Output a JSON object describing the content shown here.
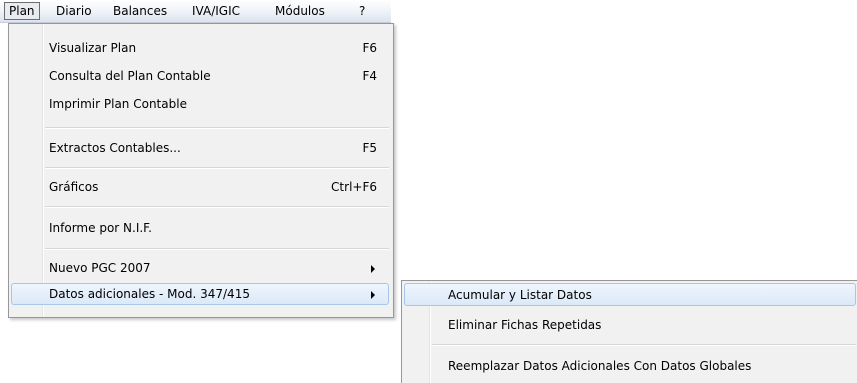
{
  "menubar": {
    "items": [
      "Plan",
      "Diario",
      "Balances",
      "IVA/IGIC",
      "Módulos",
      "?"
    ]
  },
  "plan_menu": {
    "items": [
      {
        "label": "Visualizar Plan",
        "shortcut": "F6"
      },
      {
        "label": "Consulta del Plan Contable",
        "shortcut": "F4"
      },
      {
        "label": "Imprimir Plan Contable",
        "shortcut": ""
      },
      {
        "label": "Extractos Contables...",
        "shortcut": "F5"
      },
      {
        "label": "Gráficos",
        "shortcut": "Ctrl+F6"
      },
      {
        "label": "Informe por N.I.F.",
        "shortcut": ""
      },
      {
        "label": "Nuevo PGC 2007",
        "shortcut": "",
        "submenu": true
      },
      {
        "label": "Datos adicionales - Mod. 347/415",
        "shortcut": "",
        "submenu": true,
        "highlighted": true
      }
    ]
  },
  "submenu": {
    "items": [
      {
        "label": "Acumular y Listar Datos",
        "highlighted": true
      },
      {
        "label": "Eliminar Fichas Repetidas"
      },
      {
        "label": "Reemplazar Datos Adicionales Con Datos Globales"
      }
    ]
  }
}
